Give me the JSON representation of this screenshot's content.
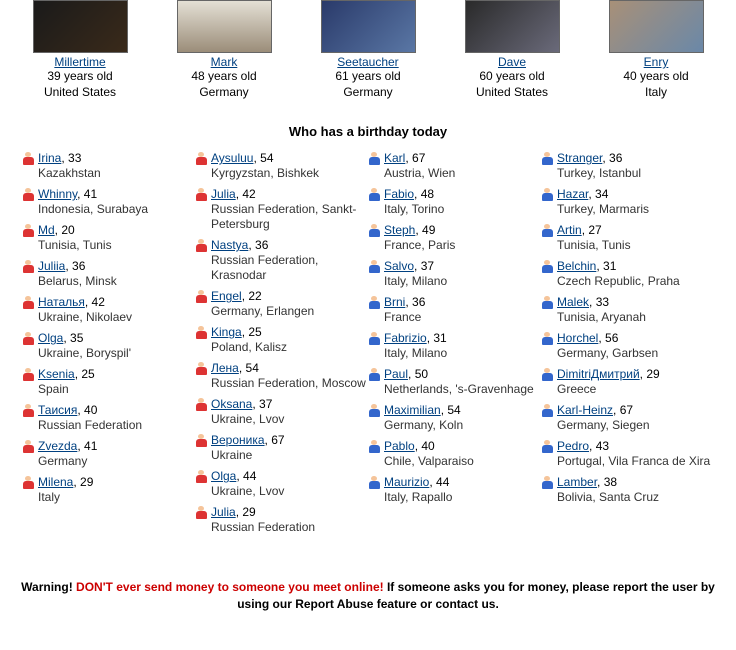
{
  "featured": [
    {
      "name": "Millertime",
      "age": "39 years old",
      "country": "United States",
      "photoClass": "p-a"
    },
    {
      "name": "Mark",
      "age": "48 years old",
      "country": "Germany",
      "photoClass": "p-b"
    },
    {
      "name": "Seetaucher",
      "age": "61 years old",
      "country": "Germany",
      "photoClass": "p-c"
    },
    {
      "name": "Dave",
      "age": "60 years old",
      "country": "United States",
      "photoClass": "p-d"
    },
    {
      "name": "Enry",
      "age": "40 years old",
      "country": "Italy",
      "photoClass": "p-e"
    }
  ],
  "section_title": "Who has a birthday today",
  "birthday_columns": [
    [
      {
        "g": "f",
        "name": "Irina",
        "age": 33,
        "loc": "Kazakhstan"
      },
      {
        "g": "f",
        "name": "Whinny",
        "age": 41,
        "loc": "Indonesia, Surabaya"
      },
      {
        "g": "f",
        "name": "Md",
        "age": 20,
        "loc": "Tunisia, Tunis"
      },
      {
        "g": "f",
        "name": "Juliia",
        "age": 36,
        "loc": "Belarus, Minsk"
      },
      {
        "g": "f",
        "name": "Наталья",
        "age": 42,
        "loc": "Ukraine, Nikolaev"
      },
      {
        "g": "f",
        "name": "Olga",
        "age": 35,
        "loc": "Ukraine, Boryspil'"
      },
      {
        "g": "f",
        "name": "Ksenia",
        "age": 25,
        "loc": "Spain"
      },
      {
        "g": "f",
        "name": "Таисия",
        "age": 40,
        "loc": "Russian Federation"
      },
      {
        "g": "f",
        "name": "Zvezda",
        "age": 41,
        "loc": "Germany"
      },
      {
        "g": "f",
        "name": "Milena",
        "age": 29,
        "loc": "Italy"
      }
    ],
    [
      {
        "g": "f",
        "name": "Aysuluu",
        "age": 54,
        "loc": "Kyrgyzstan, Bishkek"
      },
      {
        "g": "f",
        "name": "Julia",
        "age": 42,
        "loc": "Russian Federation, Sankt-Petersburg"
      },
      {
        "g": "f",
        "name": "Nastya",
        "age": 36,
        "loc": "Russian Federation, Krasnodar"
      },
      {
        "g": "f",
        "name": "Engel",
        "age": 22,
        "loc": "Germany, Erlangen"
      },
      {
        "g": "f",
        "name": "Kinga",
        "age": 25,
        "loc": "Poland, Kalisz"
      },
      {
        "g": "f",
        "name": "Лена",
        "age": 54,
        "loc": "Russian Federation, Moscow"
      },
      {
        "g": "f",
        "name": "Oksana",
        "age": 37,
        "loc": "Ukraine, Lvov"
      },
      {
        "g": "f",
        "name": "Вероника",
        "age": 67,
        "loc": "Ukraine"
      },
      {
        "g": "f",
        "name": "Olga",
        "age": 44,
        "loc": "Ukraine, Lvov"
      },
      {
        "g": "f",
        "name": "Julia",
        "age": 29,
        "loc": "Russian Federation"
      }
    ],
    [
      {
        "g": "m",
        "name": "Karl",
        "age": 67,
        "loc": "Austria, Wien"
      },
      {
        "g": "m",
        "name": "Fabio",
        "age": 48,
        "loc": "Italy, Torino"
      },
      {
        "g": "m",
        "name": "Steph",
        "age": 49,
        "loc": "France, Paris"
      },
      {
        "g": "m",
        "name": "Salvo",
        "age": 37,
        "loc": "Italy, Milano"
      },
      {
        "g": "m",
        "name": "Brni",
        "age": 36,
        "loc": "France"
      },
      {
        "g": "m",
        "name": "Fabrizio",
        "age": 31,
        "loc": "Italy, Milano"
      },
      {
        "g": "m",
        "name": "Paul",
        "age": 50,
        "loc": "Netherlands, 's-Gravenhage"
      },
      {
        "g": "m",
        "name": "Maximilian",
        "age": 54,
        "loc": "Germany, Koln"
      },
      {
        "g": "m",
        "name": "Pablo",
        "age": 40,
        "loc": "Chile, Valparaiso"
      },
      {
        "g": "m",
        "name": "Maurizio",
        "age": 44,
        "loc": "Italy, Rapallo"
      }
    ],
    [
      {
        "g": "m",
        "name": "Stranger",
        "age": 36,
        "loc": "Turkey, Istanbul"
      },
      {
        "g": "m",
        "name": "Hazar",
        "age": 34,
        "loc": "Turkey, Marmaris"
      },
      {
        "g": "m",
        "name": "Artin",
        "age": 27,
        "loc": "Tunisia, Tunis"
      },
      {
        "g": "m",
        "name": "Belchin",
        "age": 31,
        "loc": "Czech Republic, Praha"
      },
      {
        "g": "m",
        "name": "Malek",
        "age": 33,
        "loc": "Tunisia, Aryanah"
      },
      {
        "g": "m",
        "name": "Horchel",
        "age": 56,
        "loc": "Germany, Garbsen"
      },
      {
        "g": "m",
        "name": "DimitriДмитрий",
        "age": 29,
        "loc": "Greece"
      },
      {
        "g": "m",
        "name": "Karl-Heinz",
        "age": 67,
        "loc": "Germany, Siegen"
      },
      {
        "g": "m",
        "name": "Pedro",
        "age": 43,
        "loc": "Portugal, Vila Franca de Xira"
      },
      {
        "g": "m",
        "name": "Lamber",
        "age": 38,
        "loc": "Bolivia, Santa Cruz"
      }
    ]
  ],
  "warning": {
    "prefix": "Warning! ",
    "red": "DON'T ever send money to someone you meet online!",
    "suffix": " If someone asks you for money, please report the user by using our Report Abuse feature or contact us."
  }
}
